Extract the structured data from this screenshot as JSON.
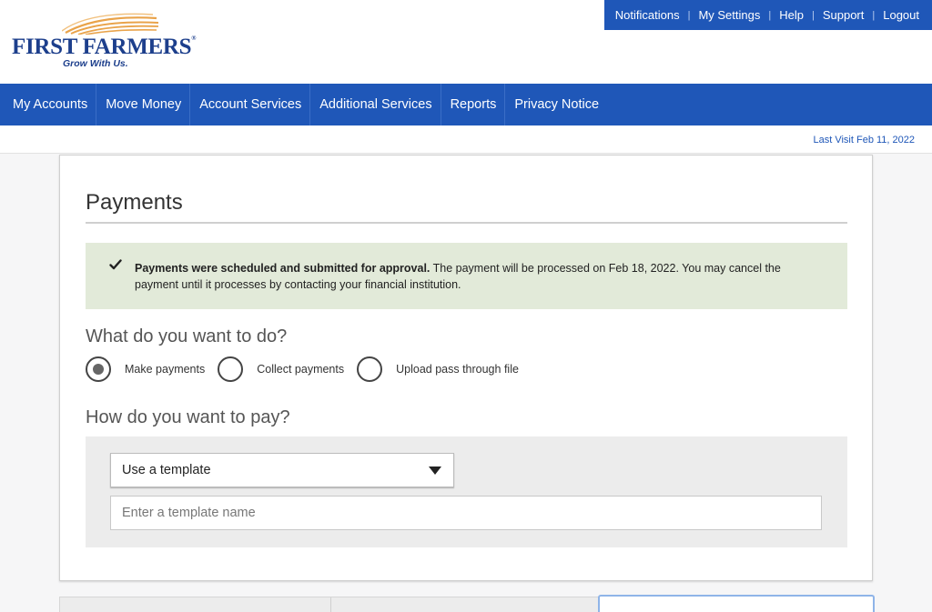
{
  "brand": {
    "name": "FIRST FARMERS",
    "tagline": "Grow With Us.",
    "colors": {
      "primary": "#1f57b8",
      "logo": "#1d3f8c",
      "sun": "#e9a34a"
    }
  },
  "utility_nav": {
    "items": [
      {
        "label": "Notifications"
      },
      {
        "label": "My Settings"
      },
      {
        "label": "Help"
      },
      {
        "label": "Support"
      },
      {
        "label": "Logout"
      }
    ]
  },
  "main_nav": {
    "items": [
      {
        "label": "My Accounts"
      },
      {
        "label": "Move Money"
      },
      {
        "label": "Account Services"
      },
      {
        "label": "Additional Services"
      },
      {
        "label": "Reports"
      },
      {
        "label": "Privacy Notice"
      }
    ]
  },
  "last_visit": "Last Visit Feb 11, 2022",
  "page": {
    "title": "Payments",
    "alert": {
      "icon": "checkmark-icon",
      "bold": "Payments were scheduled and submitted for approval.",
      "text": " The payment will be processed on Feb 18, 2022. You may cancel the payment until it processes by contacting your financial institution."
    },
    "question_action": "What do you want to do?",
    "actions": [
      {
        "label": "Make payments",
        "selected": true
      },
      {
        "label": "Collect payments",
        "selected": false
      },
      {
        "label": "Upload pass through file",
        "selected": false
      }
    ],
    "question_method": "How do you want to pay?",
    "method_select": {
      "value": "Use a template",
      "icon": "caret-down-icon"
    },
    "template_input": {
      "value": "",
      "placeholder": "Enter a template name"
    }
  }
}
